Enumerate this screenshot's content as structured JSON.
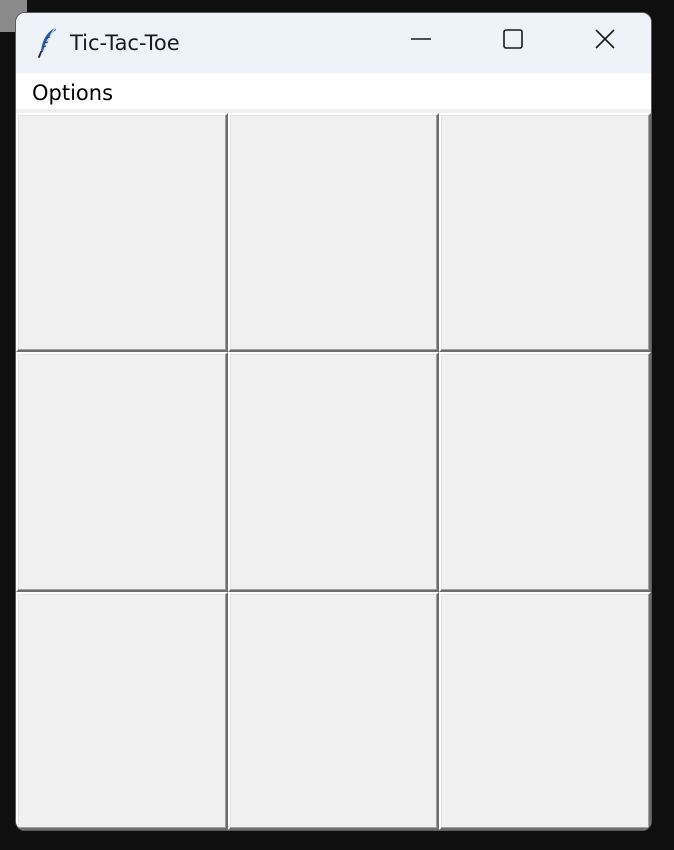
{
  "window": {
    "title": "Tic-Tac-Toe",
    "icon": "feather-icon",
    "controls": [
      "minimize-icon",
      "maximize-icon",
      "close-icon"
    ]
  },
  "menubar": {
    "items": [
      {
        "label": "Options"
      }
    ]
  },
  "board": {
    "rows": 3,
    "cols": 3,
    "cells": [
      "",
      "",
      "",
      "",
      "",
      "",
      "",
      "",
      ""
    ]
  }
}
